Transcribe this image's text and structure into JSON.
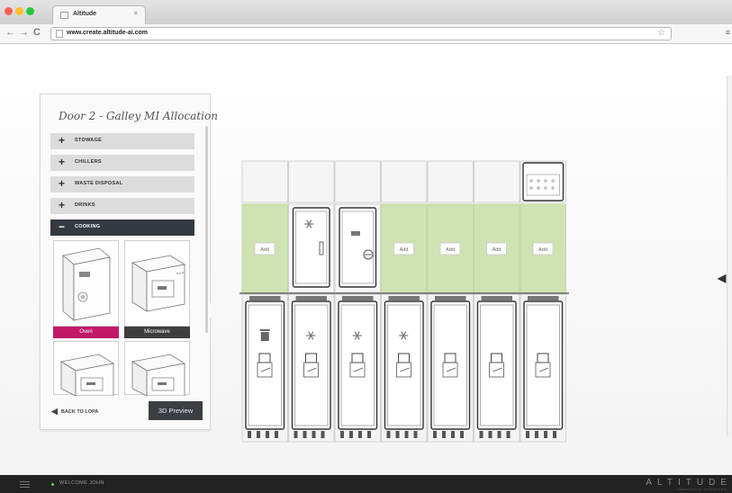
{
  "browser": {
    "tab_title": "Altitude",
    "tab_close": "×",
    "url": "www.create.altitude-ai.com",
    "back": "←",
    "forward": "→",
    "reload": "C",
    "star": "☆",
    "menu": "≡",
    "window_buttons": [
      "#ff5f57",
      "#ffbd2e",
      "#28c840"
    ]
  },
  "panel": {
    "title": "Door 2 - Galley MI Allocation",
    "categories": [
      {
        "label": "STOWAGE",
        "sign": "+"
      },
      {
        "label": "CHILLERS",
        "sign": "+"
      },
      {
        "label": "WASTE DISPOSAL",
        "sign": "+"
      },
      {
        "label": "DRINKS",
        "sign": "+"
      },
      {
        "label": "COOKING",
        "sign": "−"
      }
    ],
    "appliances": [
      {
        "name": "Oven",
        "color": "#c2186a",
        "icon": "oven-icon"
      },
      {
        "name": "Microwave",
        "color": "#3e3e3e",
        "icon": "microwave-icon"
      }
    ],
    "back_label": "BACK TO LOPA",
    "preview_label": "3D Preview"
  },
  "galley": {
    "add_label": "Add",
    "add_columns": [
      0,
      3,
      4,
      5,
      6
    ],
    "top_unit_column": 6,
    "modules": [
      {
        "column": 1,
        "type": "chiller",
        "icon": "snowflake-icon"
      },
      {
        "column": 2,
        "type": "oven",
        "icon": "oven-icon"
      }
    ],
    "carts": [
      {
        "type": "waste",
        "icon": "trash-icon"
      },
      {
        "type": "chilled",
        "icon": "snowflake-icon"
      },
      {
        "type": "chilled",
        "icon": "snowflake-icon"
      },
      {
        "type": "chilled",
        "icon": "snowflake-icon"
      },
      {
        "type": "standard",
        "icon": ""
      },
      {
        "type": "standard",
        "icon": ""
      },
      {
        "type": "standard",
        "icon": ""
      }
    ],
    "green": "#cfe3b2"
  },
  "footer": {
    "welcome": "WELCOME JOHN",
    "brand": "ALTITUDE",
    "brand_sub": "AEROSPACE INTERIORS"
  }
}
